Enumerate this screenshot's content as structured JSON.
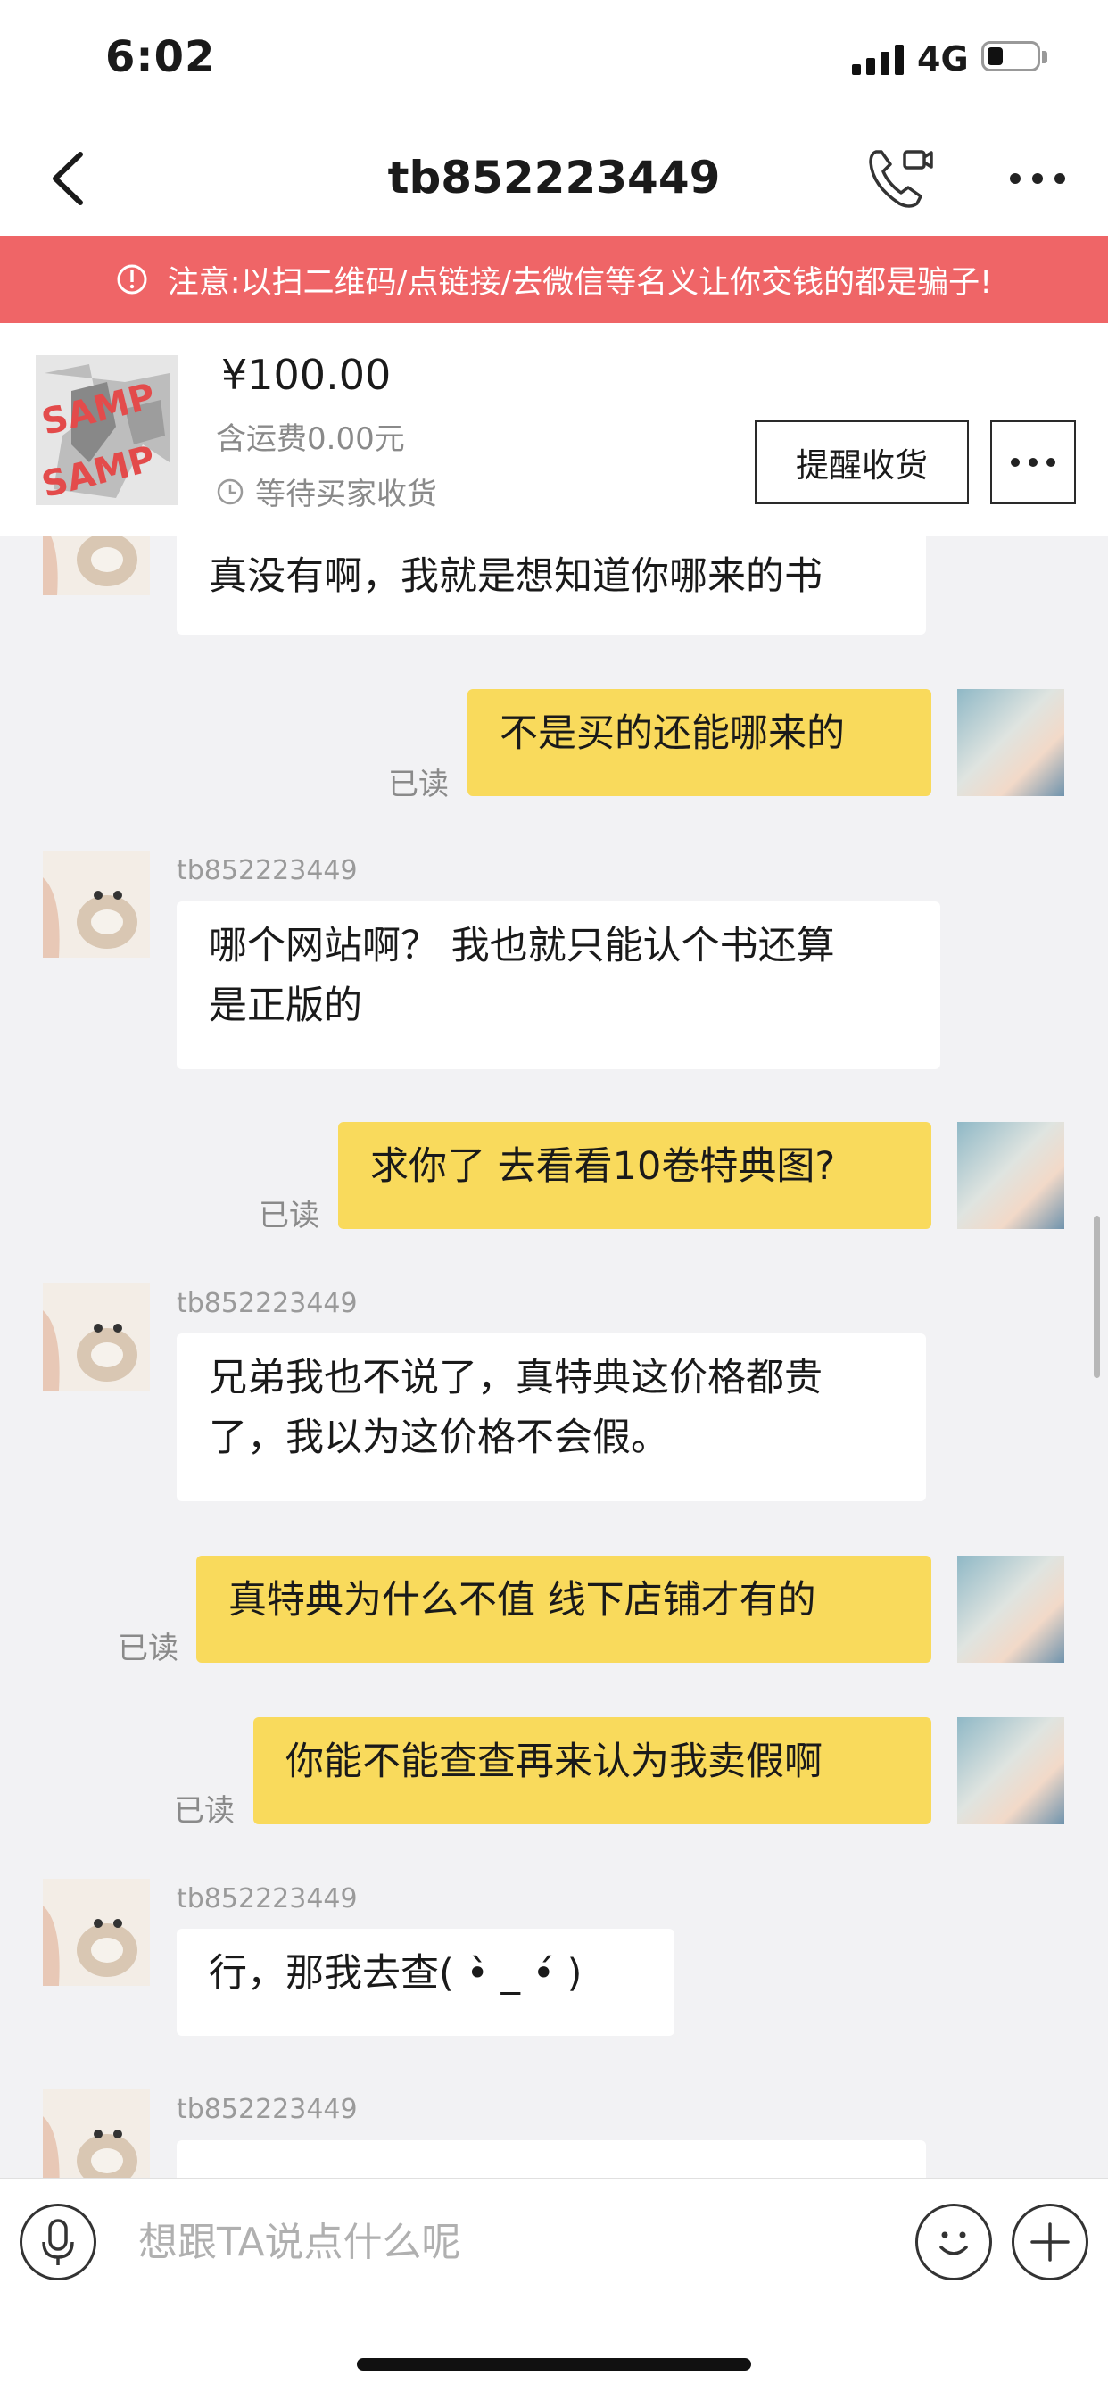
{
  "status_bar": {
    "time": "6:02",
    "network": "4G",
    "battery_level": 0.28
  },
  "nav": {
    "title": "tb852223449"
  },
  "warning": {
    "text": "注意:以扫二维码/点链接/去微信等名义让你交钱的都是骗子!"
  },
  "order": {
    "price": "¥100.00",
    "shipping": "含运费0.00元",
    "status": "等待买家收货",
    "remind_label": "提醒收货",
    "thumb_stamp": "SAMP"
  },
  "messages": [
    {
      "side": "in",
      "text": "真没有啊，我就是想知道你哪来的书"
    },
    {
      "side": "out",
      "text": "不是买的还能哪来的",
      "read": "已读"
    },
    {
      "side": "in",
      "sender": "tb852223449",
      "text_lines": [
        "哪个网站啊？ 我也就只能认个书还算",
        "是正版的"
      ]
    },
    {
      "side": "out",
      "text": "求你了 去看看10卷特典图?",
      "read": "已读"
    },
    {
      "side": "in",
      "sender": "tb852223449",
      "text_lines": [
        "兄弟我也不说了，真特典这价格都贵",
        "了，我以为这价格不会假。"
      ]
    },
    {
      "side": "out",
      "text": "真特典为什么不值 线下店铺才有的",
      "read": "已读"
    },
    {
      "side": "out",
      "text": "你能不能查查再来认为我卖假啊",
      "read": "已读"
    },
    {
      "side": "in",
      "sender": "tb852223449",
      "text": "行，那我去查( •̀ _ •́ )"
    },
    {
      "side": "in",
      "sender": "tb852223449",
      "text": ""
    }
  ],
  "input": {
    "placeholder": "想跟TA说点什么呢"
  },
  "icons": {
    "back": "back-arrow-icon",
    "call": "video-call-icon",
    "more": "more-dots-icon",
    "warning": "info-icon",
    "clock": "clock-icon",
    "voice": "microphone-icon",
    "emoji": "smiley-icon",
    "plus": "plus-icon"
  },
  "colors": {
    "warning_bg": "#ef6567",
    "outgoing_bubble": "#f9da5c",
    "incoming_bubble": "#ffffff",
    "chat_bg": "#f2f2f4"
  }
}
